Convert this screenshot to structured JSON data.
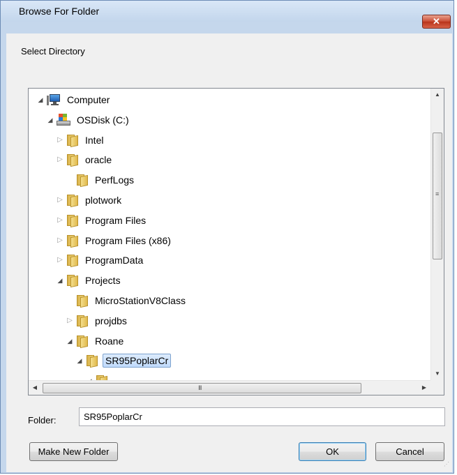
{
  "window": {
    "title": "Browse For Folder",
    "close_glyph": "✕"
  },
  "instruction": "Select Directory",
  "tree": [
    {
      "label": "Computer",
      "icon": "computer-icon",
      "toggle": "expanded"
    },
    {
      "label": "OSDisk (C:)",
      "icon": "disk-icon",
      "toggle": "expanded"
    },
    {
      "label": "Intel",
      "icon": "folder-icon",
      "toggle": "collapsed"
    },
    {
      "label": "oracle",
      "icon": "folder-icon",
      "toggle": "collapsed"
    },
    {
      "label": "PerfLogs",
      "icon": "folder-icon",
      "toggle": "none"
    },
    {
      "label": "plotwork",
      "icon": "folder-icon",
      "toggle": "collapsed"
    },
    {
      "label": "Program Files",
      "icon": "folder-icon",
      "toggle": "collapsed"
    },
    {
      "label": "Program Files (x86)",
      "icon": "folder-icon",
      "toggle": "collapsed"
    },
    {
      "label": "ProgramData",
      "icon": "folder-icon",
      "toggle": "collapsed"
    },
    {
      "label": "Projects",
      "icon": "folder-icon",
      "toggle": "expanded"
    },
    {
      "label": "MicroStationV8Class",
      "icon": "folder-icon",
      "toggle": "none"
    },
    {
      "label": "projdbs",
      "icon": "folder-icon",
      "toggle": "collapsed"
    },
    {
      "label": "Roane",
      "icon": "folder-icon",
      "toggle": "expanded"
    },
    {
      "label": "SR95PoplarCr",
      "icon": "folder-icon",
      "toggle": "expanded",
      "selected": true
    },
    {
      "label": "",
      "icon": "folder-icon",
      "toggle": "expanded"
    }
  ],
  "folder": {
    "label": "Folder:",
    "value": "SR95PoplarCr"
  },
  "buttons": {
    "new_folder": "Make New Folder",
    "ok": "OK",
    "cancel": "Cancel"
  },
  "scrollbars": {
    "vertical_grip": "≡",
    "horizontal_grip": "III"
  }
}
